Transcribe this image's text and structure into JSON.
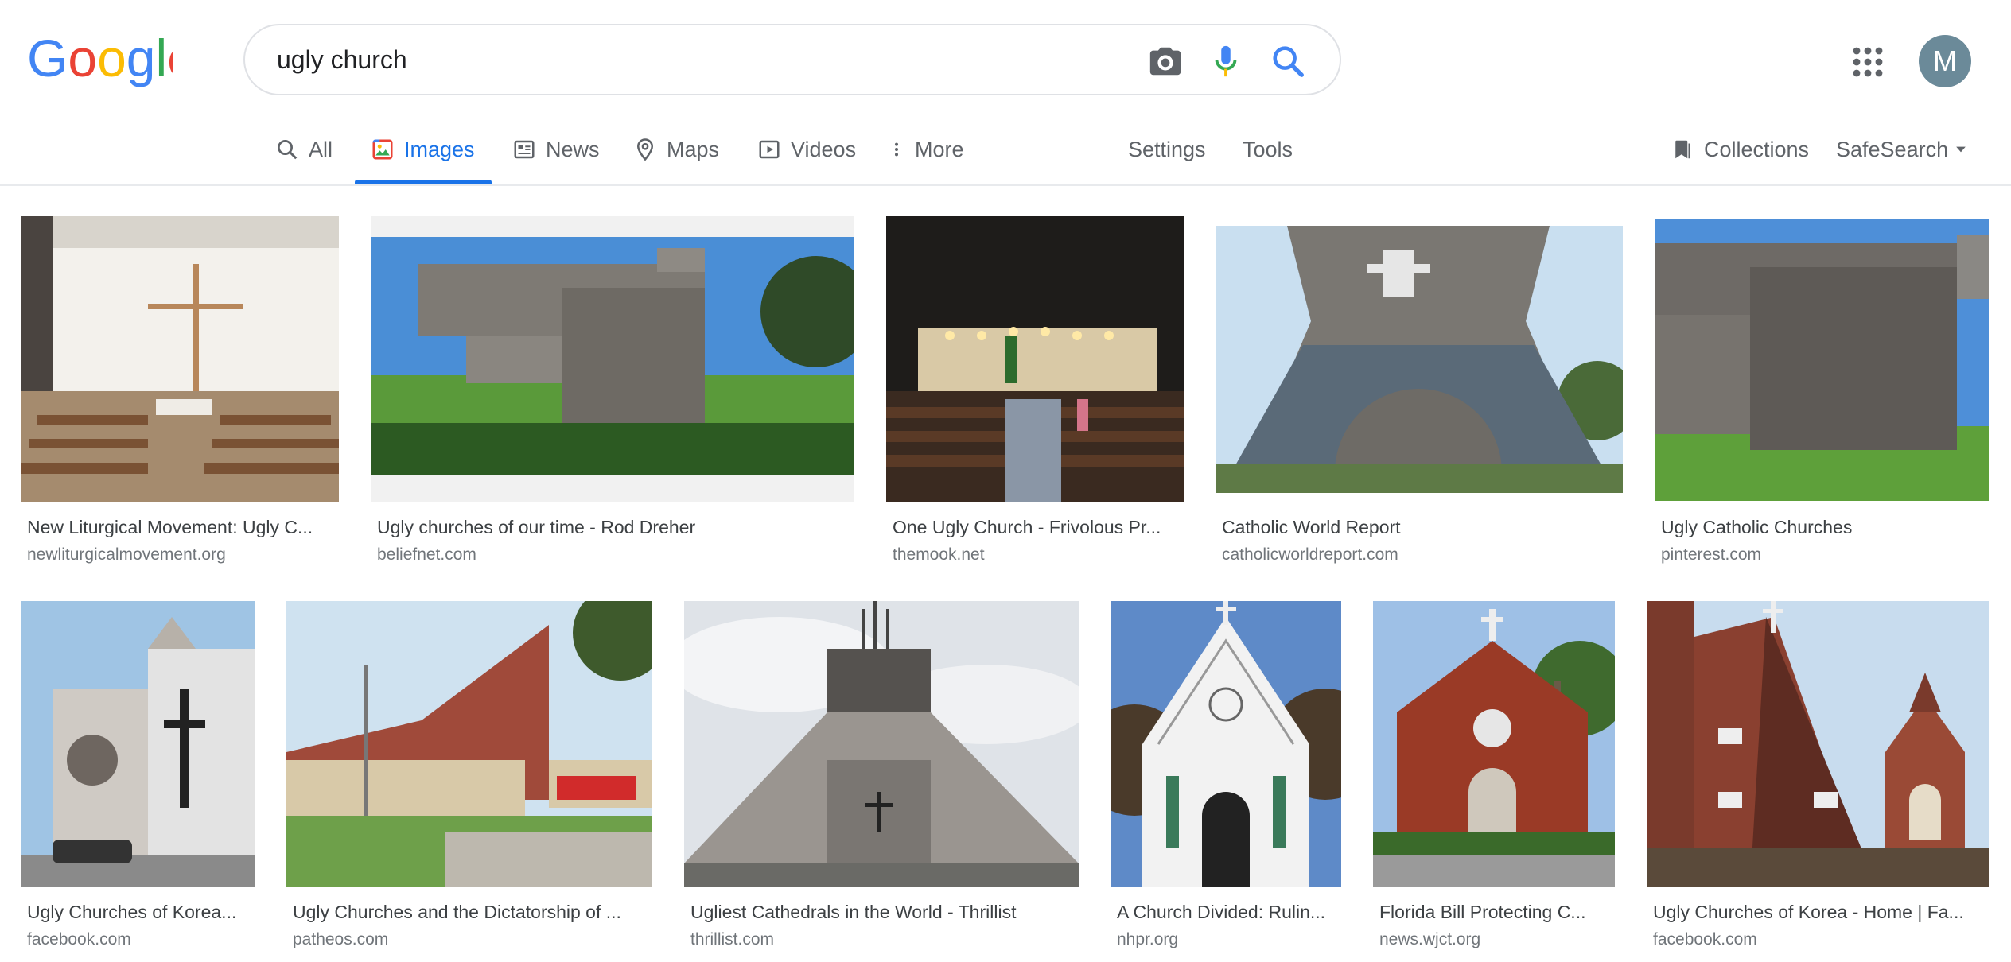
{
  "header": {
    "logo_text": "Google",
    "search_value": "ugly church",
    "avatar_letter": "M"
  },
  "tabs": {
    "all": "All",
    "images": "Images",
    "news": "News",
    "maps": "Maps",
    "videos": "Videos",
    "more": "More",
    "settings": "Settings",
    "tools": "Tools",
    "collections": "Collections",
    "safesearch": "SafeSearch"
  },
  "results_row1": [
    {
      "title": "New Liturgical Movement: Ugly C...",
      "source": "newliturgicalmovement.org"
    },
    {
      "title": "Ugly churches of our time - Rod Dreher",
      "source": "beliefnet.com"
    },
    {
      "title": "One Ugly Church - Frivolous Pr...",
      "source": "themook.net"
    },
    {
      "title": "Catholic World Report",
      "source": "catholicworldreport.com"
    },
    {
      "title": "Ugly Catholic Churches",
      "source": "pinterest.com"
    }
  ],
  "results_row2": [
    {
      "title": "Ugly Churches of Korea...",
      "source": "facebook.com"
    },
    {
      "title": "Ugly Churches and the Dictatorship of ...",
      "source": "patheos.com"
    },
    {
      "title": "Ugliest Cathedrals in the World - Thrillist",
      "source": "thrillist.com"
    },
    {
      "title": "A Church Divided: Rulin...",
      "source": "nhpr.org"
    },
    {
      "title": "Florida Bill Protecting C...",
      "source": "news.wjct.org"
    },
    {
      "title": "Ugly Churches of Korea - Home | Fa...",
      "source": "facebook.com"
    }
  ],
  "colors": {
    "google_blue": "#4285f4",
    "google_red": "#ea4335",
    "google_yellow": "#fbbc05",
    "google_green": "#34a853",
    "accent": "#1a73e8"
  }
}
